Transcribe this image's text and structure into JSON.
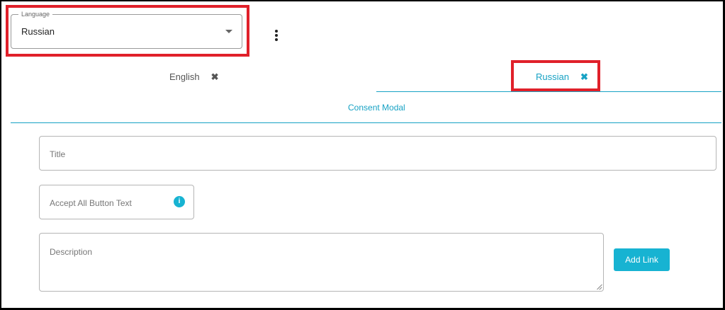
{
  "language_select": {
    "legend": "Language",
    "value": "Russian",
    "menu_icon": "kebab-menu-icon",
    "caret_icon": "dropdown-caret-icon"
  },
  "tabs": [
    {
      "label": "English",
      "close_icon": "close-icon",
      "close_glyph": "✖",
      "active": false
    },
    {
      "label": "Russian",
      "close_icon": "close-icon",
      "close_glyph": "✖",
      "active": true
    }
  ],
  "subtabs": [
    {
      "label": "Consent Modal",
      "active": true
    }
  ],
  "form": {
    "title_placeholder": "Title",
    "accept_all_placeholder": "Accept All Button Text",
    "accept_all_info_icon": "info-icon",
    "accept_all_info_glyph": "i",
    "description_placeholder": "Description",
    "add_link_label": "Add Link"
  },
  "colors": {
    "accent": "#17a2c4",
    "button": "#17b3d2",
    "highlight": "#e0202a"
  }
}
